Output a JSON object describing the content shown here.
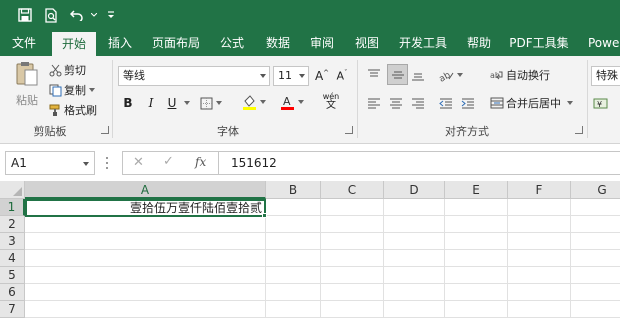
{
  "qat": {
    "icons": [
      "save-icon",
      "print-preview-icon",
      "undo-icon",
      "customize-qat-icon"
    ]
  },
  "tabs": [
    {
      "label": "文件",
      "active": false
    },
    {
      "label": "开始",
      "active": true
    },
    {
      "label": "插入",
      "active": false
    },
    {
      "label": "页面布局",
      "active": false
    },
    {
      "label": "公式",
      "active": false
    },
    {
      "label": "数据",
      "active": false
    },
    {
      "label": "审阅",
      "active": false
    },
    {
      "label": "视图",
      "active": false
    },
    {
      "label": "开发工具",
      "active": false
    },
    {
      "label": "帮助",
      "active": false
    },
    {
      "label": "PDF工具集",
      "active": false
    },
    {
      "label": "Powe",
      "active": false
    }
  ],
  "clipboard": {
    "paste_label": "粘贴",
    "cut_label": "剪切",
    "copy_label": "复制",
    "format_painter_label": "格式刷",
    "group_label": "剪贴板"
  },
  "font": {
    "font_name": "等线",
    "font_size": "11",
    "grow_icon": "A^",
    "shrink_icon": "Aˇ",
    "bold": "B",
    "italic": "I",
    "underline": "U",
    "phonetic_icon": "wén",
    "group_label": "字体"
  },
  "alignment": {
    "wrap_text_label": "自动换行",
    "merge_center_label": "合并后居中",
    "group_label": "对齐方式"
  },
  "number": {
    "format_value": "特殊"
  },
  "formula_bar": {
    "name_box": "A1",
    "fx_label": "fx",
    "formula": "151612"
  },
  "grid": {
    "columns": [
      "A",
      "B",
      "C",
      "D",
      "E",
      "F",
      "G"
    ],
    "rows": [
      "1",
      "2",
      "3",
      "4",
      "5",
      "6",
      "7"
    ],
    "selected_column": "A",
    "selected_row": "1",
    "a1_value": "壹拾伍万壹仟陆佰壹拾贰"
  },
  "colors": {
    "brand_green": "#217346",
    "highlight_yellow": "#ffff00",
    "font_red": "#ff0000"
  }
}
